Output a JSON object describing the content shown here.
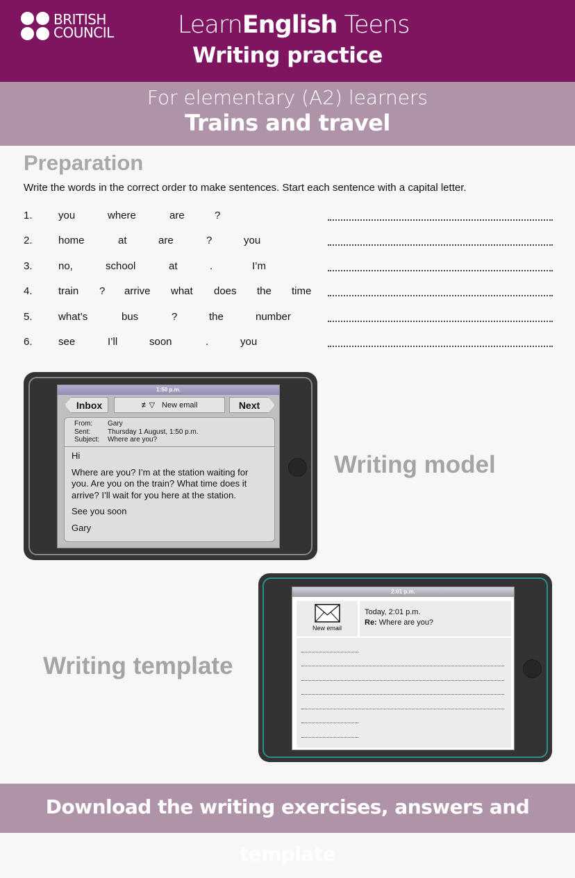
{
  "header": {
    "logo_line1": "BRITISH",
    "logo_line2": "COUNCIL",
    "brand_light": "Learn",
    "brand_bold": "English",
    "brand_suffix": " Teens",
    "subtitle": "Writing practice",
    "level": "For elementary (A2) learners",
    "topic": "Trains and travel"
  },
  "colors": {
    "primary": "#7f1461",
    "secondary": "#af94a9",
    "heading_gray": "#a8a8a8"
  },
  "preparation": {
    "title": "Preparation",
    "instruction": "Write the words in the correct order to make sentences. Start each sentence with a capital letter.",
    "items": [
      {
        "num": "1.",
        "words": [
          "you",
          "where",
          "are",
          "?"
        ]
      },
      {
        "num": "2.",
        "words": [
          "home",
          "at",
          "are",
          "?",
          "you"
        ]
      },
      {
        "num": "3.",
        "words": [
          "no,",
          "school",
          "at",
          ".",
          "I’m"
        ]
      },
      {
        "num": "4.",
        "words": [
          "train",
          "?",
          "arrive",
          "what",
          "does",
          "the",
          "time"
        ]
      },
      {
        "num": "5.",
        "words": [
          "what’s",
          "bus",
          "?",
          "the",
          "number"
        ]
      },
      {
        "num": "6.",
        "words": [
          "see",
          "I’ll",
          "soon",
          ".",
          "you"
        ]
      }
    ]
  },
  "model": {
    "label": "Writing model",
    "time": "1:50 p.m.",
    "inbox": "Inbox",
    "new_email": "New email",
    "next": "Next",
    "from_label": "From:",
    "from": "Gary",
    "sent_label": "Sent:",
    "sent": "Thursday 1 August, 1:50 p.m.",
    "subject_label": "Subject:",
    "subject": "Where are you?",
    "greeting": "Hi",
    "body": "Where are you? I’m at the station waiting for you. Are you on the train? What time does it arrive? I’ll wait for you here at the station.",
    "closing": "See you soon",
    "signature": "Gary"
  },
  "template": {
    "label": "Writing template",
    "time": "2:01 p.m.",
    "new_email": "New email",
    "date": "Today, 2:01 p.m.",
    "re_label": "Re:",
    "re_subject": " Where are you?"
  },
  "footer": {
    "text": "Download the writing exercises, answers and template"
  }
}
